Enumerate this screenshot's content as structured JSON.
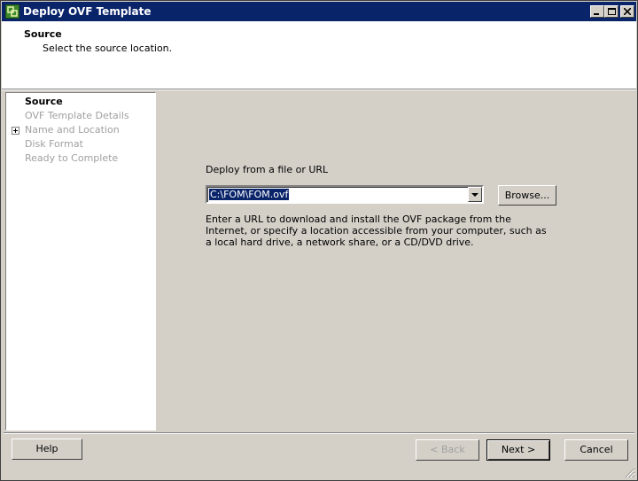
{
  "window": {
    "title": "Deploy OVF Template"
  },
  "header": {
    "title": "Source",
    "subtitle": "Select the source location."
  },
  "nav": {
    "items": [
      {
        "label": "Source",
        "state": "active"
      },
      {
        "label": "OVF Template Details",
        "state": "disabled"
      },
      {
        "label": "Name and Location",
        "state": "disabled"
      },
      {
        "label": "Disk Format",
        "state": "disabled"
      },
      {
        "label": "Ready to Complete",
        "state": "disabled"
      }
    ]
  },
  "source": {
    "label": "Deploy from a file or URL",
    "value": "C:\\FOM\\FOM.ovf",
    "browse_label": "Browse...",
    "description": "Enter a URL to download and install the OVF package from the Internet, or specify a location accessible from your computer, such as a local hard drive, a network share, or a CD/DVD drive."
  },
  "footer": {
    "help_label": "Help",
    "back_label": "< Back",
    "next_label": "Next >",
    "cancel_label": "Cancel"
  },
  "colors": {
    "titlebar": "#0a246a",
    "selection": "#0a246a",
    "face": "#d4d0c8",
    "disabled_text": "#a0a0a0"
  }
}
